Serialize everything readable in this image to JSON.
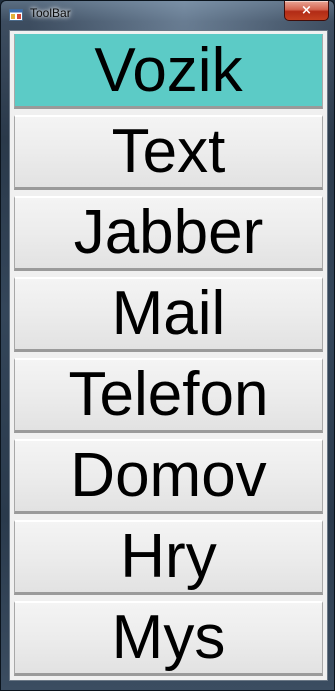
{
  "window": {
    "title": "ToolBar",
    "close_symbol": "×",
    "accent_color": "#5ccbc6"
  },
  "toolbar": {
    "buttons": [
      {
        "label": "Vozik",
        "active": true
      },
      {
        "label": "Text",
        "active": false
      },
      {
        "label": "Jabber",
        "active": false
      },
      {
        "label": "Mail",
        "active": false
      },
      {
        "label": "Telefon",
        "active": false
      },
      {
        "label": "Domov",
        "active": false
      },
      {
        "label": "Hry",
        "active": false
      },
      {
        "label": "Mys",
        "active": false
      }
    ]
  }
}
